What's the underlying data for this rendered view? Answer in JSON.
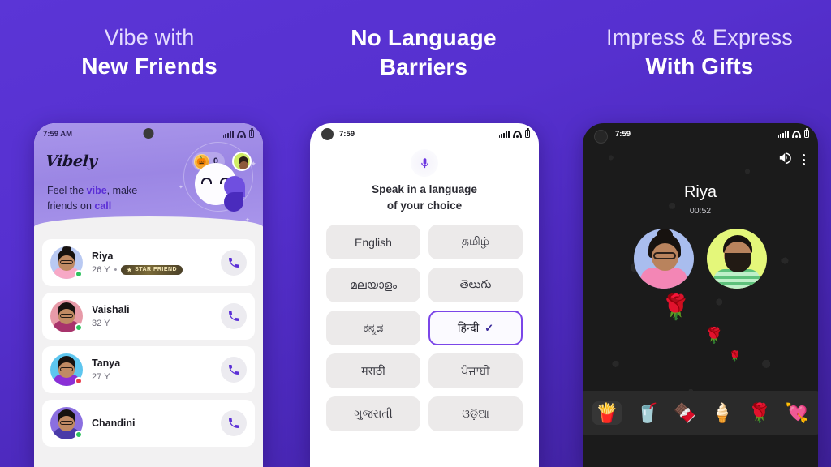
{
  "theme": {
    "bg_start": "#5b35d6",
    "bg_end": "#3f2199",
    "accent": "#5b2fd6",
    "selected_border": "#7b46e8"
  },
  "headlines": [
    {
      "line1": "Vibe with",
      "line2": "New Friends",
      "line1_bold": false
    },
    {
      "line1": "No Language",
      "line2": "Barriers",
      "line1_bold": true
    },
    {
      "line1": "Impress & Express",
      "line2": "With Gifts",
      "line1_bold": false
    }
  ],
  "phone1": {
    "status": {
      "time": "7:59 AM",
      "signal_icon": "signal-bars-icon",
      "wifi_icon": "wifi-icon",
      "battery_icon": "battery-icon"
    },
    "app_name": "Vibely",
    "coin": {
      "icon": "coin-icon",
      "glyph": "🎃",
      "count": "0"
    },
    "profile_avatar": "profile-avatar",
    "tagline": {
      "pre": "Feel the ",
      "hl1": "vibe",
      "mid": ", make",
      "line2_pre": "friends on ",
      "hl2": "call"
    },
    "contacts": [
      {
        "name": "Riya",
        "age": "26 Y",
        "separator": "•",
        "badge": "STAR FRIEND",
        "badge_icon": "star-icon",
        "status": "online",
        "ring": "#b9c9f2",
        "shirt": "#f7a8c6",
        "dot": "#2ec25e",
        "hair_bun": true
      },
      {
        "name": "Vaishali",
        "age": "32 Y",
        "separator": "",
        "badge": "",
        "badge_icon": "",
        "status": "online",
        "ring": "#e79aa8",
        "shirt": "#a8346c",
        "dot": "#2ec25e",
        "hair_bun": false
      },
      {
        "name": "Tanya",
        "age": "27 Y",
        "separator": "",
        "badge": "",
        "badge_icon": "",
        "status": "busy",
        "ring": "#5ec6ef",
        "shirt": "#8b2fd6",
        "dot": "#e8394a",
        "hair_bun": false
      },
      {
        "name": "Chandini",
        "age": "",
        "separator": "",
        "badge": "",
        "badge_icon": "",
        "status": "",
        "ring": "#8b6fe0",
        "shirt": "#4a3aa8",
        "dot": "#2ec25e",
        "hair_bun": false
      }
    ],
    "call_button_icon": "phone-call-icon"
  },
  "phone2": {
    "status": {
      "time": "7:59",
      "signal_icon": "signal-bars-icon",
      "wifi_icon": "wifi-icon",
      "battery_icon": "battery-icon"
    },
    "mic_icon": "microphone-icon",
    "title_line1": "Speak in a language",
    "title_line2": "of your choice",
    "languages": [
      {
        "label": "English",
        "selected": false
      },
      {
        "label": "தமிழ்",
        "selected": false
      },
      {
        "label": "മലയാളം",
        "selected": false
      },
      {
        "label": "తెలుగు",
        "selected": false
      },
      {
        "label": "ಕನ್ನಡ",
        "selected": false
      },
      {
        "label": "हिन्दी",
        "selected": true
      },
      {
        "label": "मराठी",
        "selected": false
      },
      {
        "label": "ਪੰਜਾਬੀ",
        "selected": false
      },
      {
        "label": "ગુજરાતી",
        "selected": false
      },
      {
        "label": "ଓଡ଼ିଆ",
        "selected": false
      }
    ],
    "check_glyph": "✓"
  },
  "phone3": {
    "status": {
      "time": "7:59",
      "signal_icon": "signal-bars-icon",
      "wifi_icon": "wifi-icon",
      "battery_icon": "battery-icon"
    },
    "speaker_icon": "speaker-icon",
    "more_icon": "kebab-menu-icon",
    "caller_name": "Riya",
    "call_timer": "00:52",
    "avatars": [
      {
        "name": "caller-avatar",
        "bg": "#a9bdee"
      },
      {
        "name": "receiver-avatar",
        "bg": "#e4f77a"
      }
    ],
    "floating_roses": [
      "🌹",
      "🌹",
      "🌹"
    ],
    "gifts": [
      {
        "name": "hi-fries-gift",
        "glyph": "🍟"
      },
      {
        "name": "iced-drink-gift",
        "glyph": "🥤"
      },
      {
        "name": "chocolate-gift",
        "glyph": "🍫"
      },
      {
        "name": "icecream-gift",
        "glyph": "🍦"
      },
      {
        "name": "rose-gift",
        "glyph": "🌹"
      },
      {
        "name": "heart-arrow-gift",
        "glyph": "💘"
      }
    ]
  }
}
